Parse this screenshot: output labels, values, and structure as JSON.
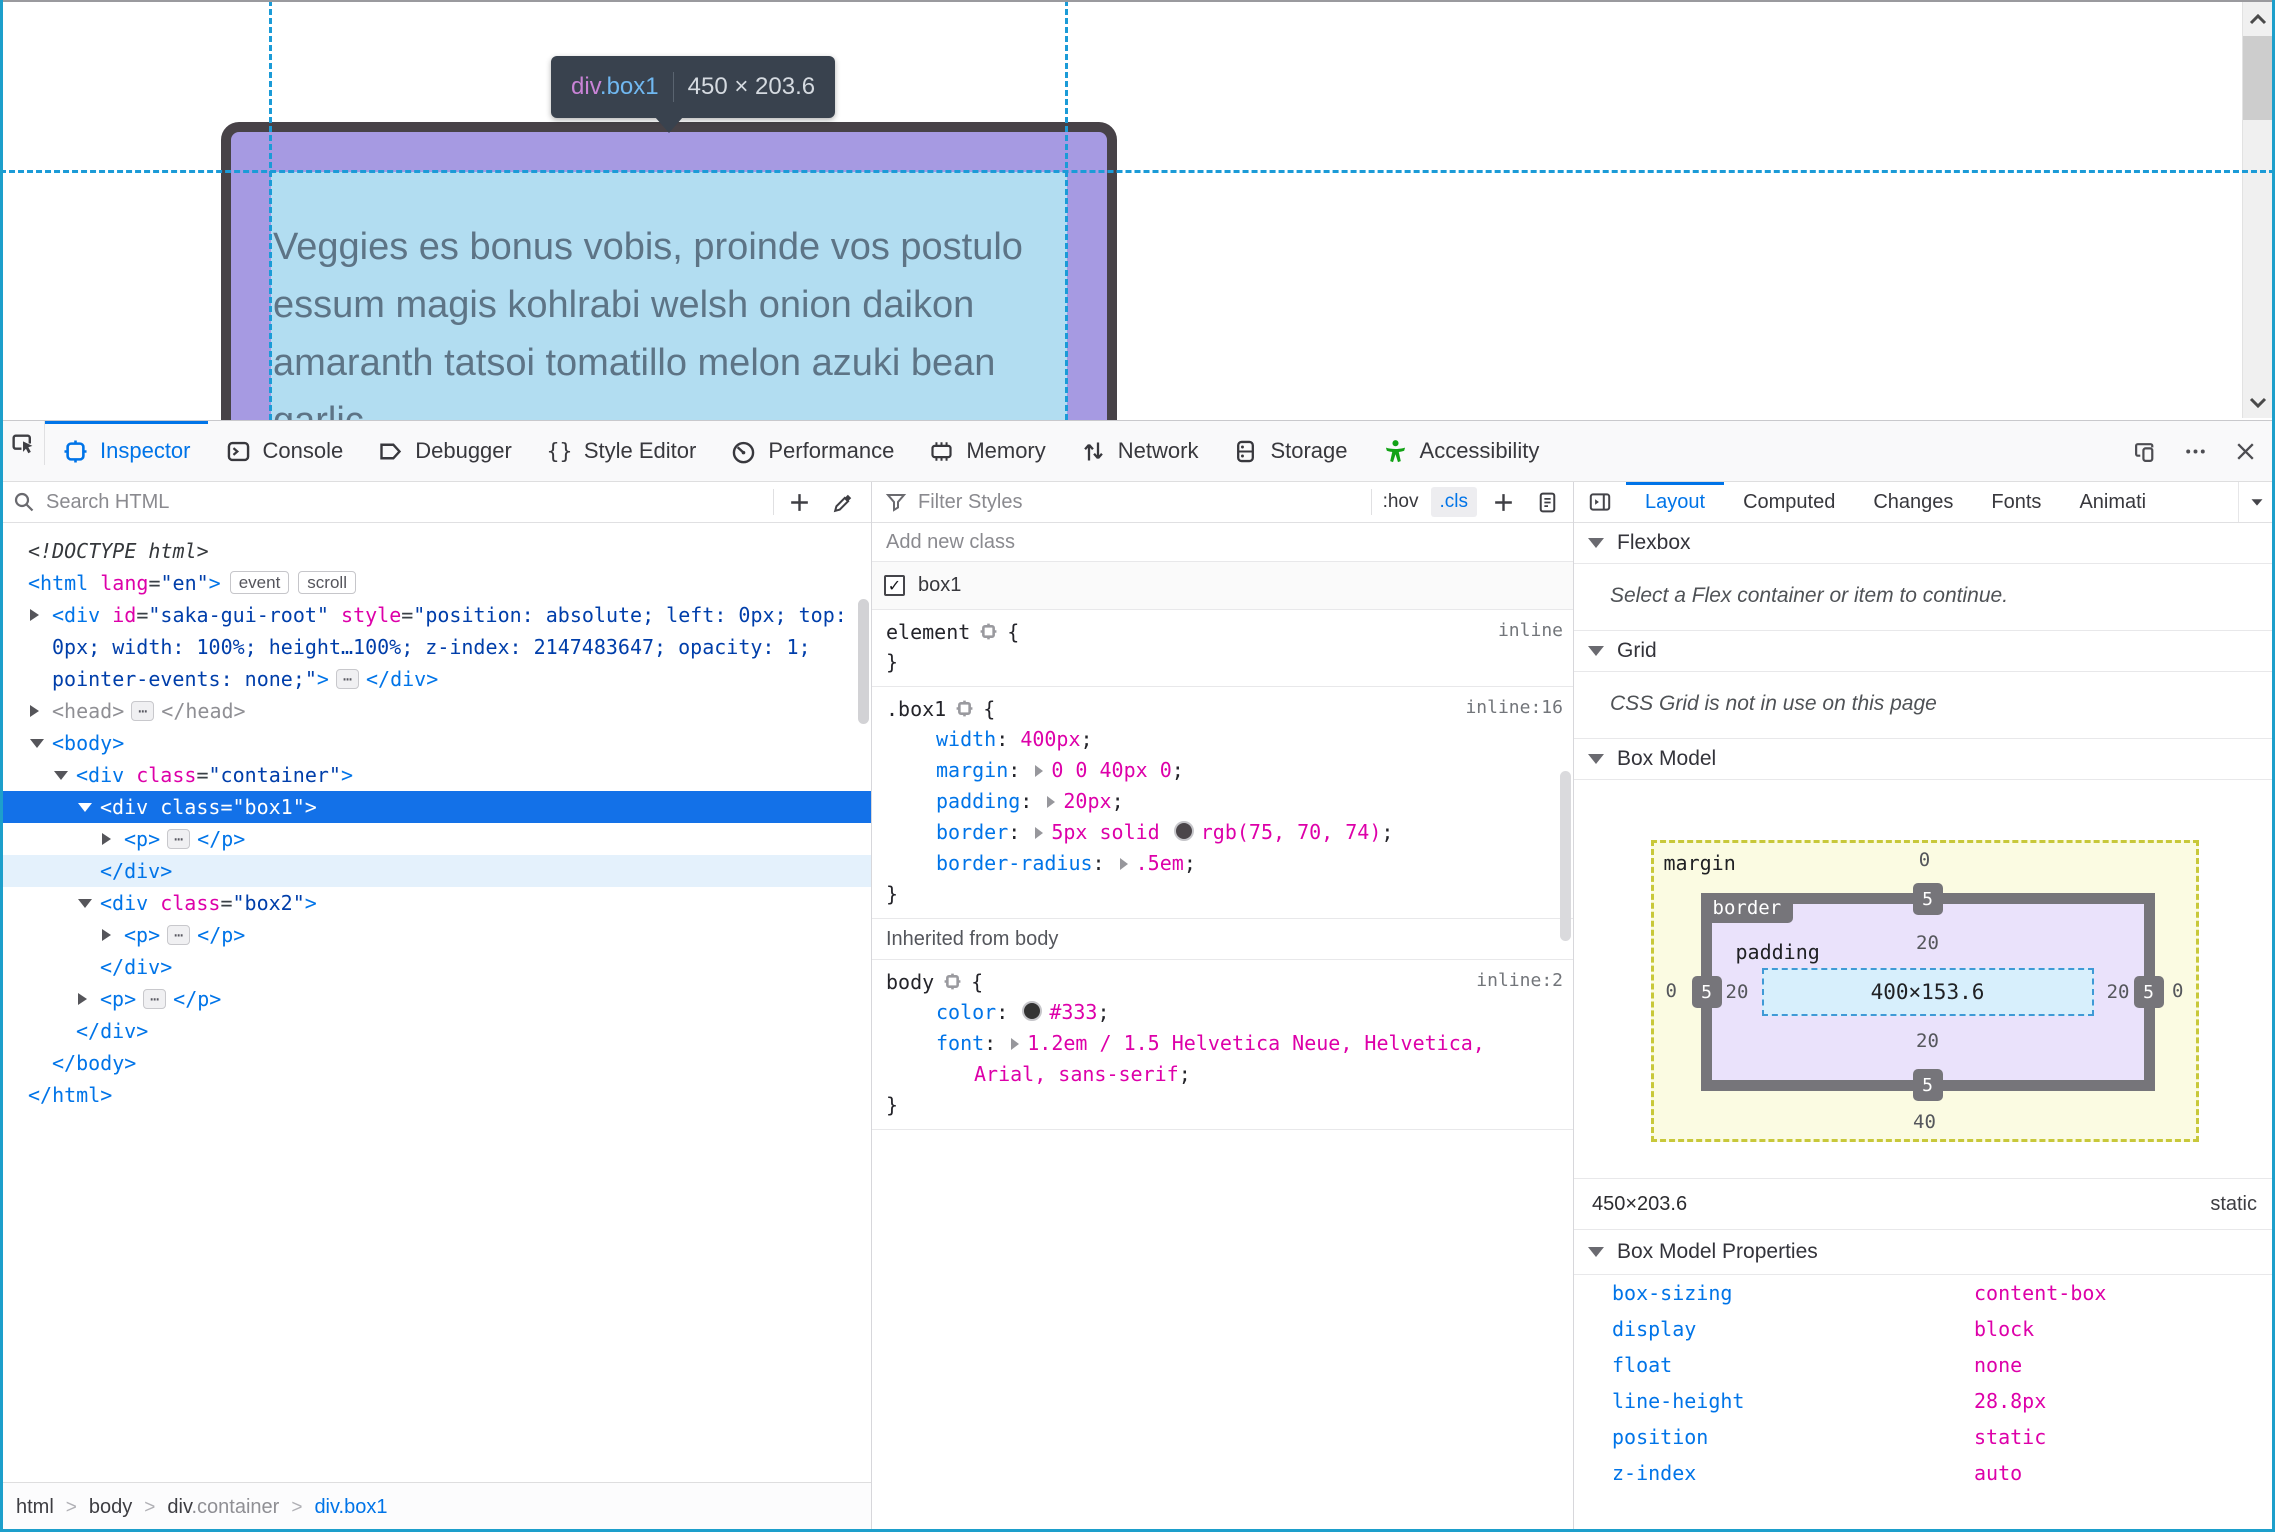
{
  "colors": {
    "accent_blue": "#0074e8",
    "value_magenta": "#dd00a9",
    "attr_value_navy": "#003eaa",
    "selection_blue": "#1371e8",
    "guide_blue": "#1b9bd7",
    "accessibility_green": "#12a215",
    "tooltip_bg": "#39424e",
    "box_border": "#4b464a",
    "padding_overlay": "#a69ae2",
    "content_overlay": "#b2ddf1",
    "margin_fill": "#fbfbe2",
    "window_edge": "#1d9fcb"
  },
  "page": {
    "tooltip": {
      "tag": "div",
      "cls": ".box1",
      "dims": "450 × 203.6"
    },
    "content_lines": [
      "Veggies es bonus vobis, proinde vos postulo",
      "essum magis kohlrabi welsh onion daikon",
      "amaranth tatsoi tomatillo melon azuki bean",
      "garlic"
    ]
  },
  "tabbar": {
    "picker_icon": "node-picker-icon",
    "tabs": [
      {
        "label": "Inspector",
        "icon": "inspector-icon",
        "active": true
      },
      {
        "label": "Console",
        "icon": "console-icon"
      },
      {
        "label": "Debugger",
        "icon": "debugger-icon"
      },
      {
        "label": "Style Editor",
        "icon": "style-editor-icon"
      },
      {
        "label": "Performance",
        "icon": "performance-icon"
      },
      {
        "label": "Memory",
        "icon": "memory-icon"
      },
      {
        "label": "Network",
        "icon": "network-icon"
      },
      {
        "label": "Storage",
        "icon": "storage-icon"
      },
      {
        "label": "Accessibility",
        "icon": "accessibility-icon"
      }
    ],
    "right_icons": [
      "responsive-mode-icon",
      "menu-icon",
      "close-icon"
    ]
  },
  "markup": {
    "search_placeholder": "Search HTML",
    "lines": [
      {
        "ind": 28,
        "parts": [
          [
            "i",
            "<!DOCTYPE html>"
          ]
        ]
      },
      {
        "ind": 28,
        "parts": [
          [
            "t",
            "<html"
          ],
          [
            "x",
            " "
          ],
          [
            "a",
            "lang"
          ],
          [
            "x",
            "="
          ],
          [
            "v",
            "\"en\""
          ],
          [
            "t",
            ">"
          ],
          [
            "b",
            "event"
          ],
          [
            "b",
            "scroll"
          ]
        ]
      },
      {
        "ind": 52,
        "tw": "r",
        "parts": [
          [
            "t",
            "<div"
          ],
          [
            "x",
            " "
          ],
          [
            "a",
            "id"
          ],
          [
            "x",
            "="
          ],
          [
            "v",
            "\"saka-gui-root\""
          ],
          [
            "x",
            " "
          ],
          [
            "a",
            "style"
          ],
          [
            "x",
            "="
          ],
          [
            "v",
            "\"position: absolute; left: 0px; top:"
          ]
        ]
      },
      {
        "ind": 52,
        "parts": [
          [
            "v",
            "0px; width: 100%; height…100%; z-index: 2147483647; opacity: 1;"
          ]
        ]
      },
      {
        "ind": 52,
        "parts": [
          [
            "v",
            "pointer-events: none;\""
          ],
          [
            "t",
            ">"
          ],
          [
            "e",
            "⋯"
          ],
          [
            "t",
            "</div>"
          ]
        ]
      },
      {
        "ind": 52,
        "tw": "r",
        "parts": [
          [
            "d",
            "<head>"
          ],
          [
            "e",
            "⋯"
          ],
          [
            "d",
            "</head>"
          ]
        ]
      },
      {
        "ind": 52,
        "tw": "v",
        "parts": [
          [
            "t",
            "<body>"
          ]
        ]
      },
      {
        "ind": 76,
        "tw": "v",
        "parts": [
          [
            "t",
            "<div"
          ],
          [
            "x",
            " "
          ],
          [
            "a",
            "class"
          ],
          [
            "x",
            "="
          ],
          [
            "v",
            "\"container\""
          ],
          [
            "t",
            ">"
          ]
        ]
      },
      {
        "ind": 100,
        "tw": "v",
        "sel": 1,
        "parts": [
          [
            "t",
            "<div"
          ],
          [
            "x",
            " "
          ],
          [
            "a",
            "class"
          ],
          [
            "x",
            "="
          ],
          [
            "v",
            "\"box1\""
          ],
          [
            "t",
            ">"
          ]
        ]
      },
      {
        "ind": 124,
        "tw": "r",
        "parts": [
          [
            "t",
            "<p>"
          ],
          [
            "e",
            "⋯"
          ],
          [
            "t",
            "</p>"
          ]
        ]
      },
      {
        "ind": 100,
        "hl": 1,
        "parts": [
          [
            "t",
            "</div>"
          ]
        ]
      },
      {
        "ind": 100,
        "tw": "v",
        "parts": [
          [
            "t",
            "<div"
          ],
          [
            "x",
            " "
          ],
          [
            "a",
            "class"
          ],
          [
            "x",
            "="
          ],
          [
            "v",
            "\"box2\""
          ],
          [
            "t",
            ">"
          ]
        ]
      },
      {
        "ind": 124,
        "tw": "r",
        "parts": [
          [
            "t",
            "<p>"
          ],
          [
            "e",
            "⋯"
          ],
          [
            "t",
            "</p>"
          ]
        ]
      },
      {
        "ind": 100,
        "parts": [
          [
            "t",
            "</div>"
          ]
        ]
      },
      {
        "ind": 100,
        "tw": "r",
        "parts": [
          [
            "t",
            "<p>"
          ],
          [
            "e",
            "⋯"
          ],
          [
            "t",
            "</p>"
          ]
        ]
      },
      {
        "ind": 76,
        "parts": [
          [
            "t",
            "</div>"
          ]
        ]
      },
      {
        "ind": 52,
        "parts": [
          [
            "t",
            "</body>"
          ]
        ]
      },
      {
        "ind": 28,
        "parts": [
          [
            "t",
            "</html>"
          ]
        ]
      }
    ],
    "breadcrumb": [
      {
        "label": "html"
      },
      {
        "label": "body"
      },
      {
        "label": "div",
        "secondary": ".container"
      },
      {
        "label": "div.box1",
        "active": true
      }
    ]
  },
  "styles": {
    "filter_placeholder": "Filter Styles",
    "hov_label": ":hov",
    "cls_label": ".cls",
    "add_class_placeholder": "Add new class",
    "class_toggle": {
      "label": "box1",
      "checked": true
    },
    "rules": [
      {
        "selector": "element",
        "link": "inline",
        "props": []
      },
      {
        "selector": ".box1",
        "link": "inline:16",
        "props": [
          {
            "name": "width",
            "parts": [
              "400px"
            ]
          },
          {
            "name": "margin",
            "arrow": true,
            "parts": [
              "0 0 40px 0"
            ]
          },
          {
            "name": "padding",
            "arrow": true,
            "parts": [
              "20px"
            ]
          },
          {
            "name": "border",
            "arrow": true,
            "parts": [
              "5px solid ",
              {
                "sw": "#4b464a"
              },
              "rgb(75, 70, 74)"
            ]
          },
          {
            "name": "border-radius",
            "arrow": true,
            "parts": [
              ".5em"
            ]
          }
        ]
      }
    ],
    "inherited_header": "Inherited from body",
    "body_rule": {
      "selector": "body",
      "link": "inline:2",
      "props": [
        {
          "name": "color",
          "parts": [
            {
              "sw": "#333333"
            },
            "#333"
          ]
        },
        {
          "name": "font",
          "arrow": true,
          "parts": [
            "1.2em / 1.5 Helvetica Neue, Helvetica, Arial, sans-serif"
          ]
        }
      ]
    }
  },
  "layout": {
    "sidebar_tabs": [
      {
        "label": "Layout",
        "active": true
      },
      {
        "label": "Computed"
      },
      {
        "label": "Changes"
      },
      {
        "label": "Fonts"
      },
      {
        "label": "Animati"
      }
    ],
    "flexbox": {
      "title": "Flexbox",
      "message": "Select a Flex container or item to continue."
    },
    "grid": {
      "title": "Grid",
      "message": "CSS Grid is not in use on this page"
    },
    "box_model": {
      "title": "Box Model",
      "margin": {
        "label": "margin",
        "top": "0",
        "right": "0",
        "bottom": "40",
        "left": "0"
      },
      "border": {
        "label": "border",
        "top": "5",
        "right": "5",
        "bottom": "5",
        "left": "5"
      },
      "padding": {
        "label": "padding",
        "top": "20",
        "right": "20",
        "bottom": "20",
        "left": "20"
      },
      "content": "400×153.6",
      "dims": "450×203.6",
      "position": "static",
      "properties_title": "Box Model Properties",
      "properties": [
        [
          "box-sizing",
          "content-box"
        ],
        [
          "display",
          "block"
        ],
        [
          "float",
          "none"
        ],
        [
          "line-height",
          "28.8px"
        ],
        [
          "position",
          "static"
        ],
        [
          "z-index",
          "auto"
        ]
      ]
    }
  }
}
